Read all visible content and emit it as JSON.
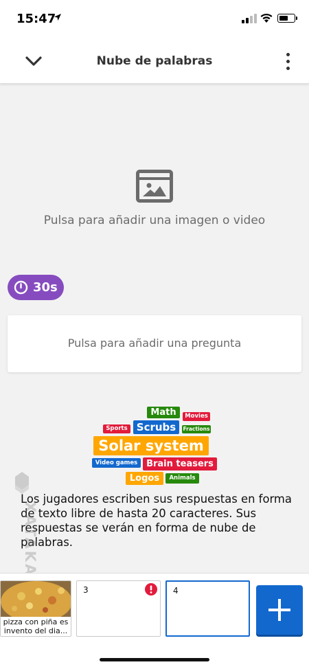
{
  "status_bar": {
    "time": "15:47",
    "icons": [
      "location-arrow-icon",
      "signal-icon",
      "wifi-icon",
      "battery-icon"
    ]
  },
  "header": {
    "title": "Nube de palabras",
    "back_icon": "chevron-down-icon",
    "menu_icon": "more-vertical-icon"
  },
  "media": {
    "icon": "image-icon",
    "label": "Pulsa para añadir una imagen o video"
  },
  "timer": {
    "icon": "clock-icon",
    "value": "30s",
    "color": "#864cbf"
  },
  "question": {
    "placeholder": "Pulsa para añadir una pregunta"
  },
  "word_cloud": {
    "words": [
      {
        "text": "Math",
        "color": "#26890c"
      },
      {
        "text": "Movies",
        "color": "#e21b3c"
      },
      {
        "text": "Sports",
        "color": "#e21b3c"
      },
      {
        "text": "Scrubs",
        "color": "#1368ce"
      },
      {
        "text": "Fractions",
        "color": "#26890c"
      },
      {
        "text": "Solar system",
        "color": "#ffa602"
      },
      {
        "text": "Video games",
        "color": "#1368ce"
      },
      {
        "text": "Brain teasers",
        "color": "#e21b3c"
      },
      {
        "text": "Logos",
        "color": "#ffa602"
      },
      {
        "text": "Animals",
        "color": "#26890c"
      }
    ]
  },
  "description": "Los jugadores escriben sus respuestas en forma de texto libre de hasta 20 caracteres. Sus respuestas se verán en forma de nube de palabras.",
  "watermark": {
    "text": "XATAKA BASICS"
  },
  "slides": [
    {
      "number": "",
      "caption": "pizza con piña es invento del dia...",
      "has_image": true
    },
    {
      "number": "3",
      "warning": true
    },
    {
      "number": "4",
      "selected": true
    }
  ],
  "add_button": {
    "icon": "plus-icon",
    "color": "#1368ce"
  }
}
